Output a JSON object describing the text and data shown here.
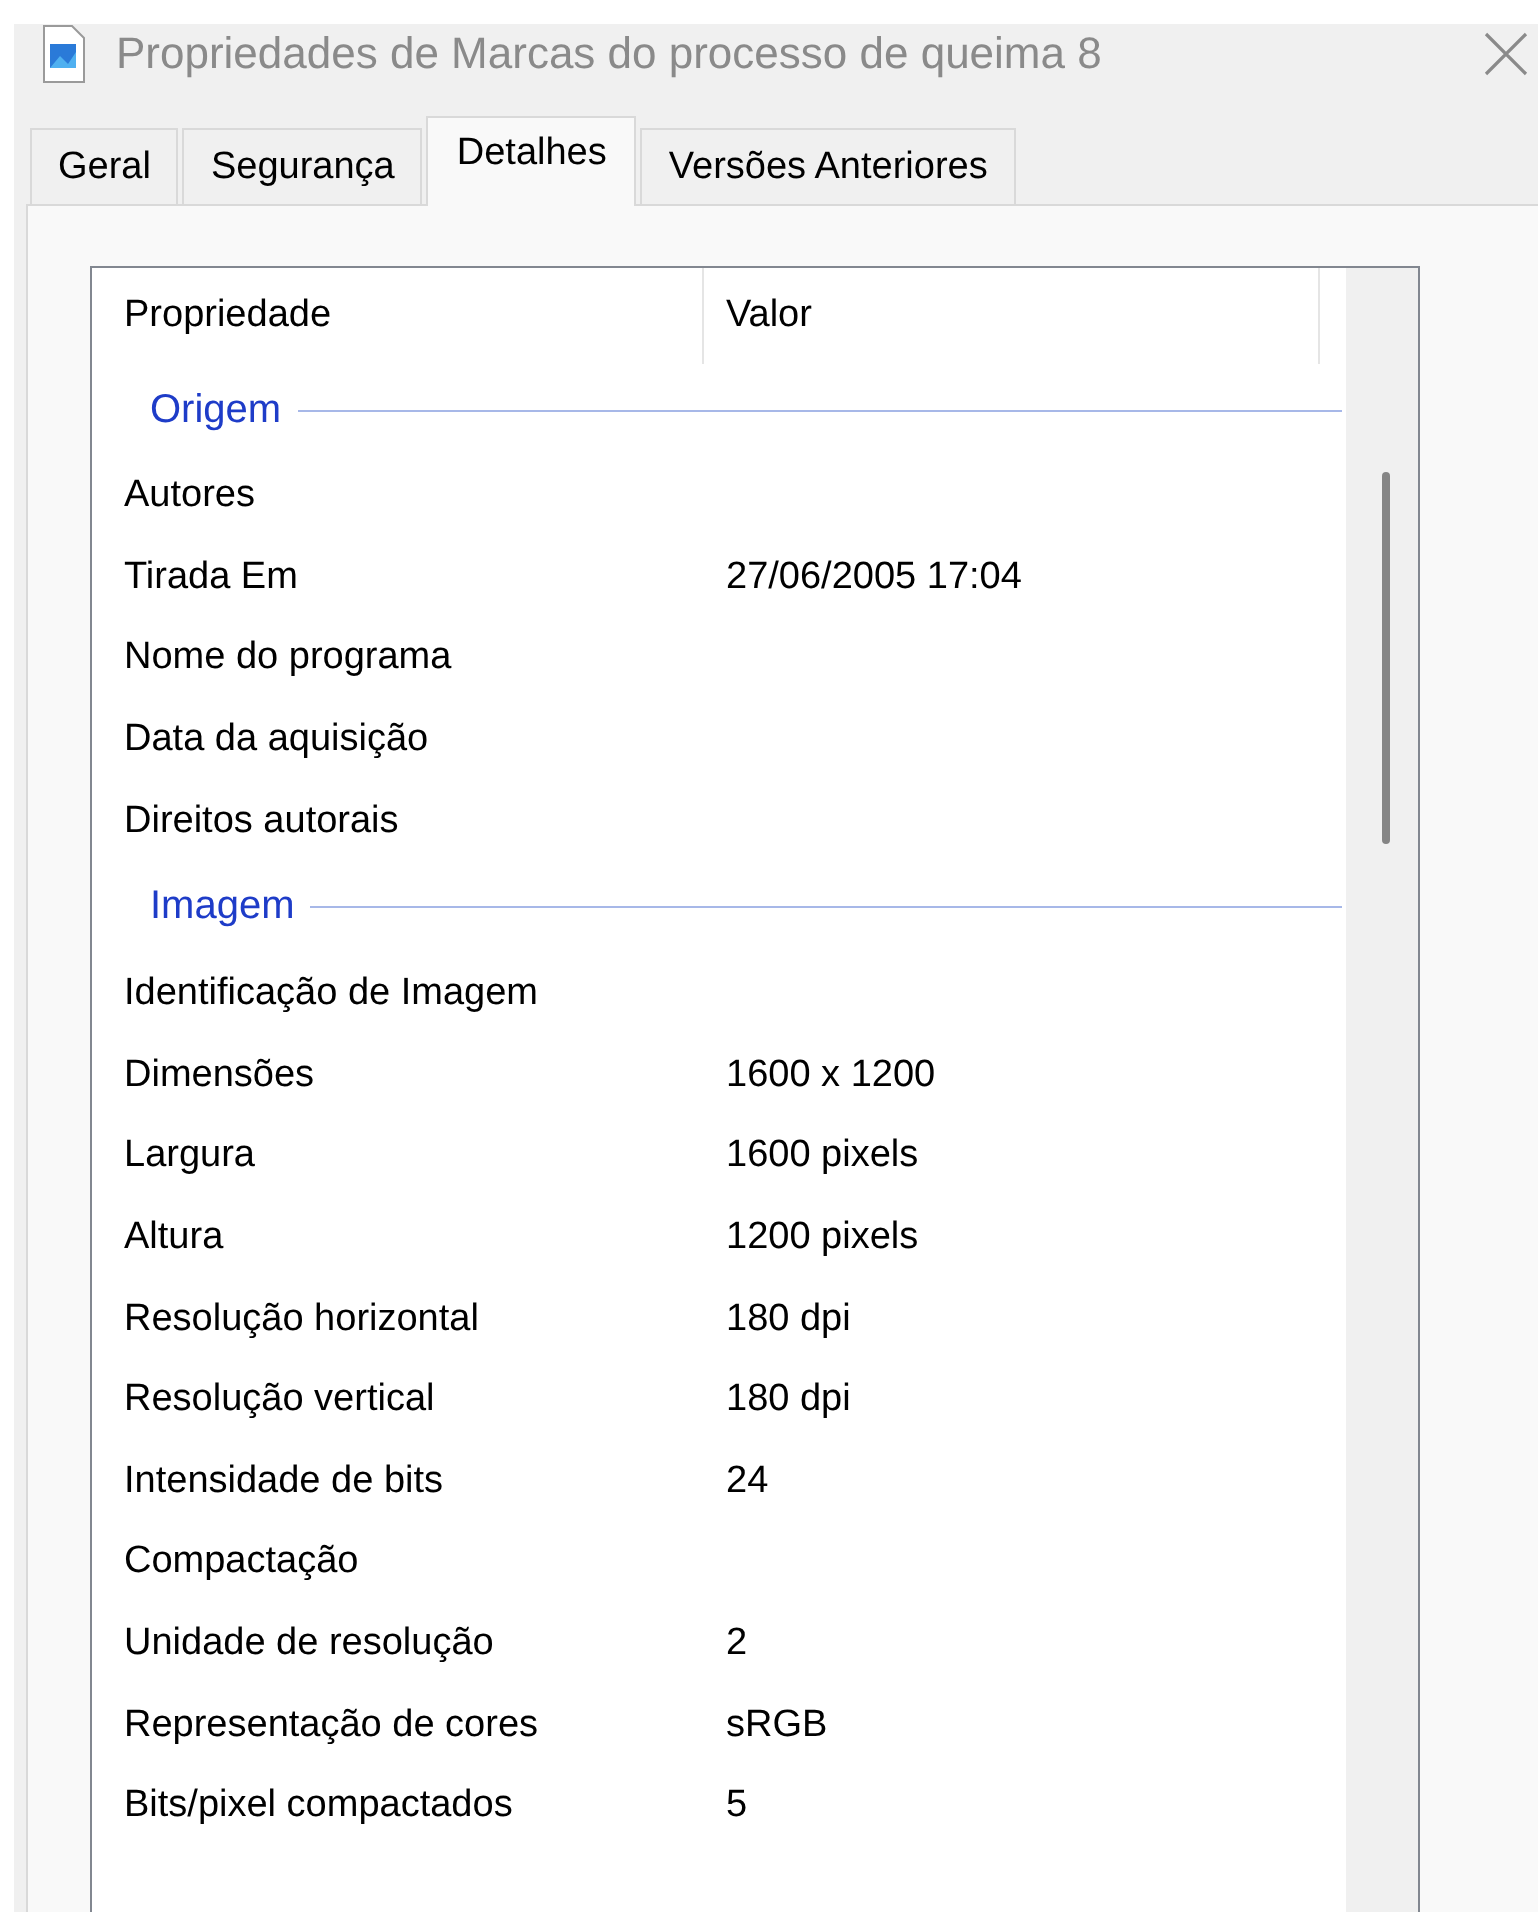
{
  "window": {
    "title": "Propriedades de Marcas do processo de queima 8"
  },
  "tabs": [
    {
      "label": "Geral",
      "selected": false
    },
    {
      "label": "Segurança",
      "selected": false
    },
    {
      "label": "Detalhes",
      "selected": true
    },
    {
      "label": "Versões Anteriores",
      "selected": false
    }
  ],
  "table": {
    "columns": [
      "Propriedade",
      "Valor"
    ],
    "groups": [
      {
        "name": "Origem",
        "rows": [
          {
            "property": "Autores"
          },
          {
            "property": "Tirada Em",
            "value": "27/06/2005 17:04"
          },
          {
            "property": "Nome do programa"
          },
          {
            "property": "Data da aquisição"
          },
          {
            "property": "Direitos autorais"
          }
        ]
      },
      {
        "name": "Imagem",
        "rows": [
          {
            "property": "Identificação de Imagem"
          },
          {
            "property": "Dimensões",
            "value": "1600 x 1200"
          },
          {
            "property": "Largura",
            "value": "1600 pixels"
          },
          {
            "property": "Altura",
            "value": "1200 pixels"
          },
          {
            "property": "Resolução horizontal",
            "value": "180 dpi"
          },
          {
            "property": "Resolução vertical",
            "value": "180 dpi"
          },
          {
            "property": "Intensidade de bits",
            "value": "24"
          },
          {
            "property": "Compactação"
          },
          {
            "property": "Unidade de resolução",
            "value": "2"
          },
          {
            "property": "Representação de cores",
            "value": "sRGB"
          },
          {
            "property": "Bits/pixel compactados",
            "value": "5"
          }
        ]
      }
    ]
  }
}
